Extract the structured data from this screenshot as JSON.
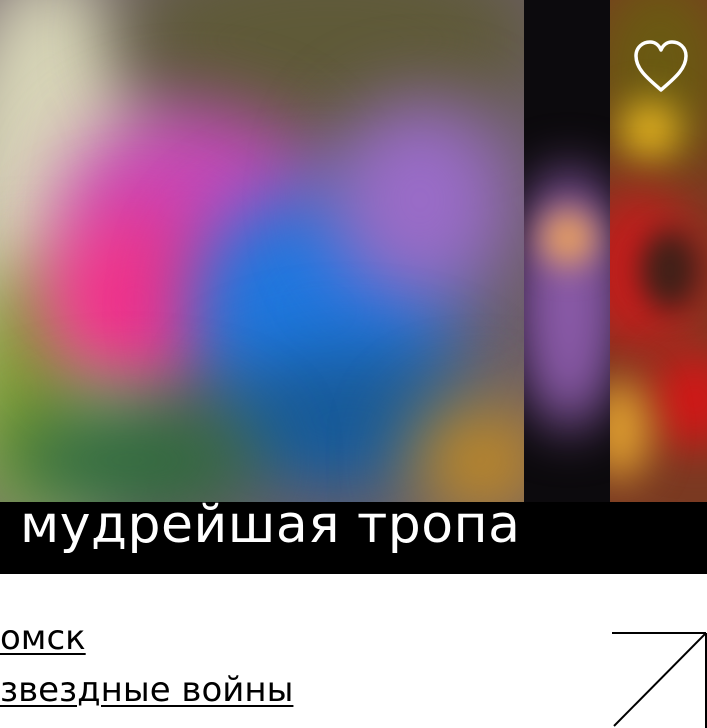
{
  "card": {
    "title": "мудрейшая тропа",
    "favorite_icon": "heart-outline-icon",
    "open_icon": "arrow-diagonal-icon"
  },
  "tags": [
    {
      "label": "омск"
    },
    {
      "label": "звездные войны"
    }
  ],
  "colors": {
    "title_bar_bg": "#000000",
    "title_text": "#ffffff",
    "page_bg": "#ffffff",
    "tag_text": "#000000"
  }
}
